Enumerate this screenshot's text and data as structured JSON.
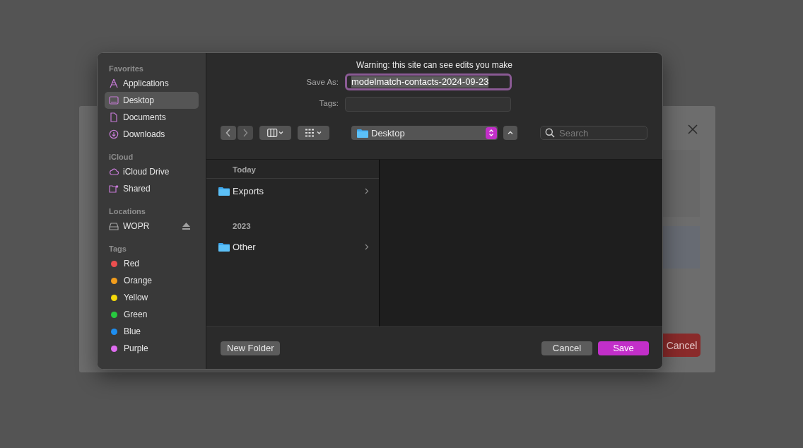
{
  "background_dialog": {
    "cancel_button": "Cancel"
  },
  "save_dialog": {
    "sidebar": [
      {
        "title": "Favorites",
        "items": [
          {
            "label": "Applications",
            "kind": "place",
            "selected": false
          },
          {
            "label": "Desktop",
            "kind": "place",
            "selected": true
          },
          {
            "label": "Documents",
            "kind": "place",
            "selected": false
          },
          {
            "label": "Downloads",
            "kind": "place",
            "selected": false
          }
        ]
      },
      {
        "title": "iCloud",
        "items": [
          {
            "label": "iCloud Drive",
            "kind": "place",
            "selected": false
          },
          {
            "label": "Shared",
            "kind": "place",
            "selected": false
          }
        ]
      },
      {
        "title": "Locations",
        "items": [
          {
            "label": "WOPR",
            "kind": "place",
            "ejectable": true,
            "selected": false
          }
        ]
      },
      {
        "title": "Tags",
        "items": [
          {
            "label": "Red",
            "kind": "tag",
            "color": "#eb4f4f",
            "selected": false
          },
          {
            "label": "Orange",
            "kind": "tag",
            "color": "#f29d1c",
            "selected": false
          },
          {
            "label": "Yellow",
            "kind": "tag",
            "color": "#f5d90a",
            "selected": false
          },
          {
            "label": "Green",
            "kind": "tag",
            "color": "#27c93f",
            "selected": false
          },
          {
            "label": "Blue",
            "kind": "tag",
            "color": "#1e8ef0",
            "selected": false
          },
          {
            "label": "Purple",
            "kind": "tag",
            "color": "#df6cf0",
            "selected": false
          }
        ]
      }
    ],
    "warning": "Warning: this site can see edits you make",
    "save_as": {
      "label": "Save As:",
      "value": "modelmatch-contacts-2024-09-23"
    },
    "tags": {
      "label": "Tags:"
    },
    "location": "Desktop",
    "search": {
      "placeholder": "Search"
    },
    "browser": [
      {
        "title": "Today",
        "items": [
          {
            "label": "Exports",
            "selected": false
          }
        ]
      },
      {
        "title": "2023",
        "items": [
          {
            "label": "Other",
            "selected": false
          }
        ]
      }
    ],
    "buttons": {
      "new_folder": "New Folder",
      "cancel": "Cancel",
      "save": "Save"
    }
  }
}
